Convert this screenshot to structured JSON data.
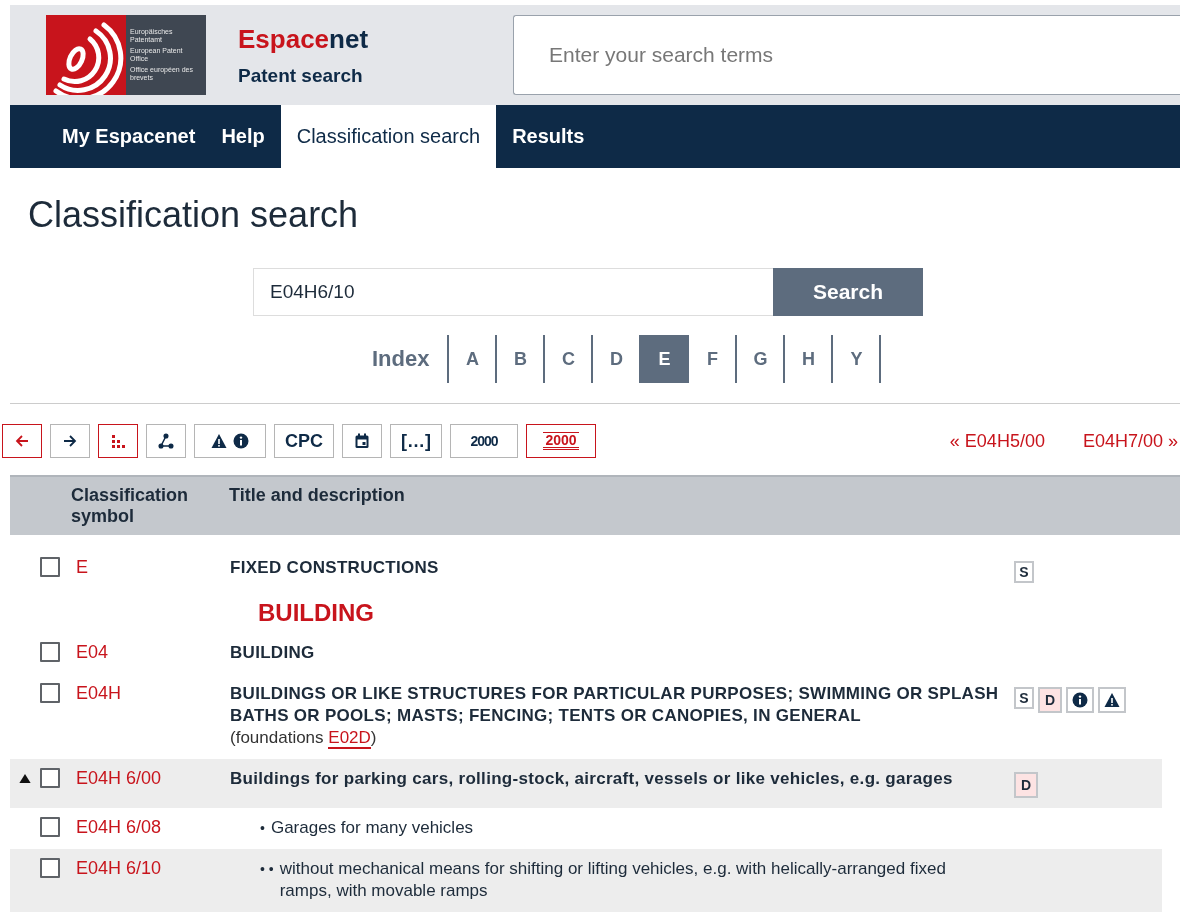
{
  "logo": {
    "lines": [
      "Europäisches Patentamt",
      "European Patent Office",
      "Office européen des brevets"
    ]
  },
  "brand": {
    "title_parts": [
      "Espace",
      "net"
    ],
    "subtitle": "Patent search"
  },
  "search": {
    "placeholder": "Enter your search terms"
  },
  "nav": [
    {
      "label": "My Espacenet",
      "selected": false
    },
    {
      "label": "Help",
      "selected": false
    },
    {
      "label": "Classification search",
      "selected": true
    },
    {
      "label": "Results",
      "selected": false
    }
  ],
  "page_title": "Classification search",
  "classification_search": {
    "value": "E04H6/10",
    "button": "Search"
  },
  "index": {
    "label": "Index",
    "letters": [
      {
        "label": "A",
        "selected": false
      },
      {
        "label": "B",
        "selected": false
      },
      {
        "label": "C",
        "selected": false
      },
      {
        "label": "D",
        "selected": false
      },
      {
        "label": "E",
        "selected": true
      },
      {
        "label": "F",
        "selected": false
      },
      {
        "label": "G",
        "selected": false
      },
      {
        "label": "H",
        "selected": false
      },
      {
        "label": "Y",
        "selected": false
      }
    ]
  },
  "toolbar": [
    {
      "kind": "back",
      "active": true
    },
    {
      "kind": "forward",
      "active": false
    },
    {
      "kind": "tree",
      "active": true
    },
    {
      "kind": "angle",
      "active": false
    },
    {
      "kind": "warn-info",
      "active": false
    },
    {
      "kind": "text",
      "label": "CPC",
      "active": false
    },
    {
      "kind": "calendar",
      "active": false
    },
    {
      "kind": "text",
      "label": "[…]",
      "active": false
    },
    {
      "kind": "strike",
      "label": "2000",
      "active": false
    },
    {
      "kind": "underline",
      "label": "2000",
      "active": true
    }
  ],
  "pager": {
    "previous": "« E04H5/00",
    "next": "E04H7/00 »"
  },
  "table": {
    "columns": [
      "Classification symbol",
      "Title and description"
    ],
    "rows": [
      {
        "kind": "entry",
        "symbol": "E",
        "title": "FIXED CONSTRUCTIONS",
        "bold": true,
        "checked": false,
        "highlighted": false,
        "badges": [
          {
            "kind": "letter",
            "label": "S",
            "tinted": false
          }
        ]
      },
      {
        "kind": "heading",
        "title": "BUILDING"
      },
      {
        "kind": "entry",
        "symbol": "E04",
        "title": "BUILDING",
        "bold": true,
        "checked": false,
        "highlighted": false
      },
      {
        "kind": "entry",
        "symbol": "E04H",
        "title": "BUILDINGS OR LIKE STRUCTURES FOR PARTICULAR PURPOSES; SWIMMING OR SPLASH BATHS OR POOLS; MASTS; FENCING; TENTS OR CANOPIES, IN GENERAL",
        "bold": true,
        "checked": false,
        "highlighted": false,
        "note": {
          "before": "(foundations ",
          "link": "E02D",
          "after": ")"
        },
        "badges": [
          {
            "kind": "letter",
            "label": "S",
            "tinted": false
          },
          {
            "kind": "letter",
            "label": "D",
            "tinted": true
          },
          {
            "kind": "info"
          },
          {
            "kind": "warning"
          }
        ]
      },
      {
        "kind": "entry",
        "symbol": "E04H 6/00",
        "title": "Buildings for parking cars, rolling-stock, aircraft, vessels or like vehicles, e.g. garages",
        "bold": true,
        "checked": false,
        "highlighted": true,
        "expanded": true,
        "badges": [
          {
            "kind": "letter",
            "label": "D",
            "tinted": true
          }
        ]
      },
      {
        "kind": "entry",
        "symbol": "E04H 6/08",
        "dots": "•",
        "title": "Garages for many vehicles",
        "bold": false,
        "checked": false,
        "highlighted": false
      },
      {
        "kind": "entry",
        "symbol": "E04H 6/10",
        "dots": "• •",
        "title": "without mechanical means for shifting or lifting vehicles, e.g. with helically-arranged fixed ramps, with movable ramps",
        "bold": false,
        "checked": false,
        "highlighted": true
      }
    ]
  }
}
